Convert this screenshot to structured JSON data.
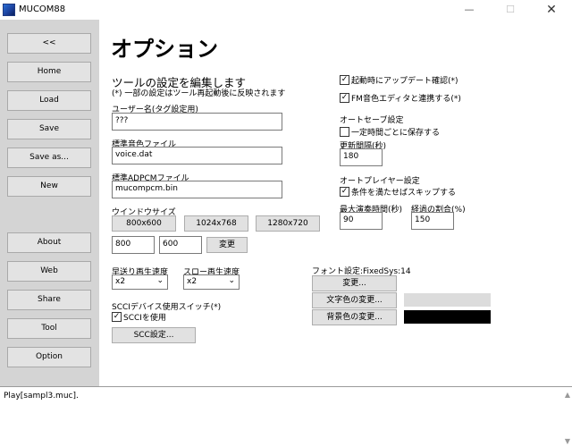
{
  "window": {
    "title": "MUCOM88",
    "min_glyph": "—",
    "max_glyph": "☐",
    "close_glyph": "✕"
  },
  "sidebar": {
    "items": [
      {
        "label": "<<"
      },
      {
        "label": "Home"
      },
      {
        "label": "Load"
      },
      {
        "label": "Save"
      },
      {
        "label": "Save as..."
      },
      {
        "label": "New"
      },
      {
        "label": "About"
      },
      {
        "label": "Web"
      },
      {
        "label": "Share"
      },
      {
        "label": "Tool"
      },
      {
        "label": "Option"
      }
    ]
  },
  "page": {
    "title": "オプション",
    "subtitle": "ツールの設定を編集します",
    "note": "(*) 一部の設定はツール再起動後に反映されます"
  },
  "username": {
    "label": "ユーザー名(タグ設定用)",
    "value": "???"
  },
  "voice_file": {
    "label": "標準音色ファイル",
    "value": "voice.dat"
  },
  "adpcm_file": {
    "label": "標準ADPCMファイル",
    "value": "mucompcm.bin"
  },
  "window_size": {
    "label": "ウインドウサイズ",
    "presets": [
      "800x600",
      "1024x768",
      "1280x720"
    ],
    "width": "800",
    "height": "600",
    "apply_label": "変更"
  },
  "ff_speed": {
    "label": "早送り再生速度",
    "value": "x2"
  },
  "slow_speed": {
    "label": "スロー再生速度",
    "value": "x2"
  },
  "scci": {
    "label": "SCCIデバイス使用スイッチ(*)",
    "use_label": "SCCIを使用",
    "use_checked": true,
    "settings_label": "SCC設定..."
  },
  "startup_update": {
    "label": "起動時にアップデート確認(*)",
    "checked": true
  },
  "fm_editor": {
    "label": "FM音色エディタと連携する(*)",
    "checked": true
  },
  "autosave": {
    "heading": "オートセーブ設定",
    "periodic_label": "一定時間ごとに保存する",
    "periodic_checked": false,
    "interval_label": "更新間隔(秒)",
    "interval_value": "180"
  },
  "autoplayer": {
    "heading": "オートプレイヤー設定",
    "skip_label": "条件を満たせばスキップする",
    "skip_checked": true,
    "max_time_label": "最大演奏時間(秒)",
    "max_time_value": "90",
    "ratio_label": "経過の割合(%)",
    "ratio_value": "150"
  },
  "font": {
    "label": "フォント設定:FixedSys:14",
    "change_label": "変更...",
    "text_color_label": "文字色の変更...",
    "text_color": "#dcdcdc",
    "bg_color_label": "背景色の変更...",
    "bg_color": "#000000"
  },
  "status": {
    "text": "Play[sampl3.muc]."
  },
  "check_glyph": "✓"
}
